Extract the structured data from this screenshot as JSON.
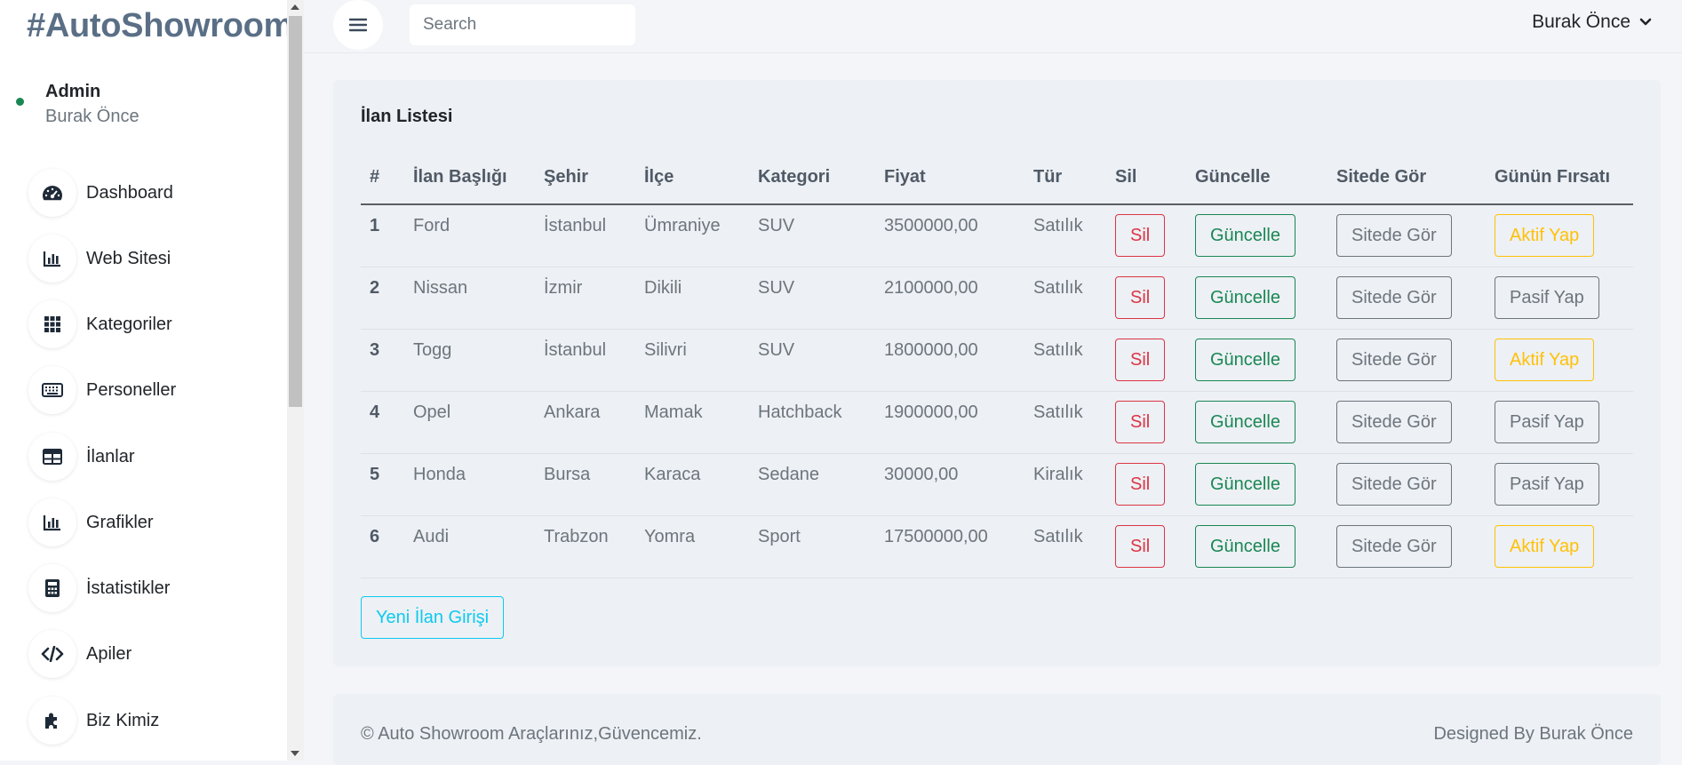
{
  "sidebar": {
    "brand": "#AutoShowroom",
    "user_role": "Admin",
    "user_name": "Burak Önce",
    "items": [
      {
        "label": "Dashboard",
        "icon": "speedometer-icon"
      },
      {
        "label": "Web Sitesi",
        "icon": "bar-chart-icon"
      },
      {
        "label": "Kategoriler",
        "icon": "grid-icon"
      },
      {
        "label": "Personeller",
        "icon": "keyboard-icon"
      },
      {
        "label": "İlanlar",
        "icon": "table-icon"
      },
      {
        "label": "Grafikler",
        "icon": "bar-chart-icon"
      },
      {
        "label": "İstatistikler",
        "icon": "calculator-icon"
      },
      {
        "label": "Apiler",
        "icon": "code-icon"
      },
      {
        "label": "Biz Kimiz",
        "icon": "puzzle-icon"
      }
    ]
  },
  "topbar": {
    "search_placeholder": "Search",
    "user_menu": "Burak Önce"
  },
  "card": {
    "title": "İlan Listesi",
    "headers": [
      "#",
      "İlan Başlığı",
      "Şehir",
      "İlçe",
      "Kategori",
      "Fiyat",
      "Tür",
      "Sil",
      "Güncelle",
      "Sitede Gör",
      "Günün Fırsatı"
    ],
    "rows": [
      {
        "id": "1",
        "title": "Ford",
        "city": "İstanbul",
        "district": "Ümraniye",
        "category": "SUV",
        "price": "3500000,00",
        "type": "Satılık",
        "del": "Sil",
        "update": "Güncelle",
        "view": "Sitede Gör",
        "deal": "Aktif Yap",
        "deal_style": "warning"
      },
      {
        "id": "2",
        "title": "Nissan",
        "city": "İzmir",
        "district": "Dikili",
        "category": "SUV",
        "price": "2100000,00",
        "type": "Satılık",
        "del": "Sil",
        "update": "Güncelle",
        "view": "Sitede Gör",
        "deal": "Pasif Yap",
        "deal_style": "secondary"
      },
      {
        "id": "3",
        "title": "Togg",
        "city": "İstanbul",
        "district": "Silivri",
        "category": "SUV",
        "price": "1800000,00",
        "type": "Satılık",
        "del": "Sil",
        "update": "Güncelle",
        "view": "Sitede Gör",
        "deal": "Aktif Yap",
        "deal_style": "warning"
      },
      {
        "id": "4",
        "title": "Opel",
        "city": "Ankara",
        "district": "Mamak",
        "category": "Hatchback",
        "price": "1900000,00",
        "type": "Satılık",
        "del": "Sil",
        "update": "Güncelle",
        "view": "Sitede Gör",
        "deal": "Pasif Yap",
        "deal_style": "secondary"
      },
      {
        "id": "5",
        "title": "Honda",
        "city": "Bursa",
        "district": "Karaca",
        "category": "Sedane",
        "price": "30000,00",
        "type": "Kiralık",
        "del": "Sil",
        "update": "Güncelle",
        "view": "Sitede Gör",
        "deal": "Pasif Yap",
        "deal_style": "secondary"
      },
      {
        "id": "6",
        "title": "Audi",
        "city": "Trabzon",
        "district": "Yomra",
        "category": "Sport",
        "price": "17500000,00",
        "type": "Satılık",
        "del": "Sil",
        "update": "Güncelle",
        "view": "Sitede Gör",
        "deal": "Aktif Yap",
        "deal_style": "warning"
      }
    ],
    "new_button": "Yeni İlan Girişi"
  },
  "footer": {
    "left": "© Auto Showroom Araçlarınız,Güvencemiz.",
    "right": "Designed By Burak Önce"
  }
}
